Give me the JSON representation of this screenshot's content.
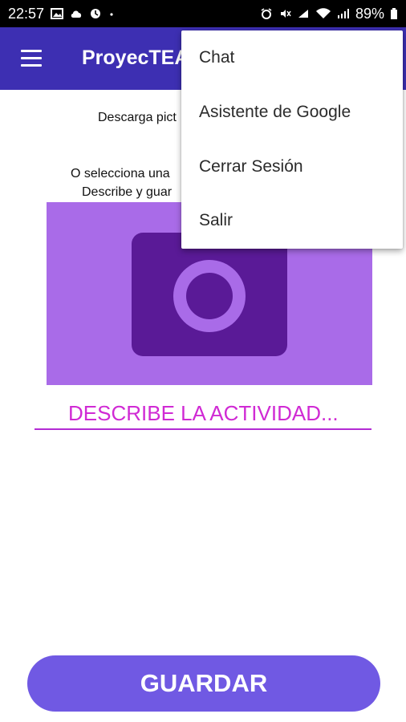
{
  "status_bar": {
    "time": "22:57",
    "battery": "89%",
    "left_icons": [
      "image-icon",
      "cloud-icon",
      "clock-icon",
      "dot-icon"
    ],
    "right_icons": [
      "alarm-icon",
      "mute-icon",
      "lte-icon",
      "wifi-icon",
      "signal-icon",
      "battery-icon"
    ]
  },
  "app_bar": {
    "title": "ProyecTEA",
    "color": "#3d2fb2"
  },
  "content": {
    "instruction_1": "Descarga pict",
    "instruction_2": "O selecciona una",
    "instruction_3": "Describe y guar",
    "describe_placeholder": "DESCRIBE LA ACTIVIDAD...",
    "accent_color": "#d02ad4",
    "photo_icon": "camera-icon"
  },
  "save_button": {
    "label": "GUARDAR",
    "color": "#7059e3"
  },
  "overflow_menu": {
    "items": [
      {
        "label": "Chat"
      },
      {
        "label": "Asistente de Google"
      },
      {
        "label": "Cerrar Sesión"
      },
      {
        "label": "Salir"
      }
    ]
  }
}
